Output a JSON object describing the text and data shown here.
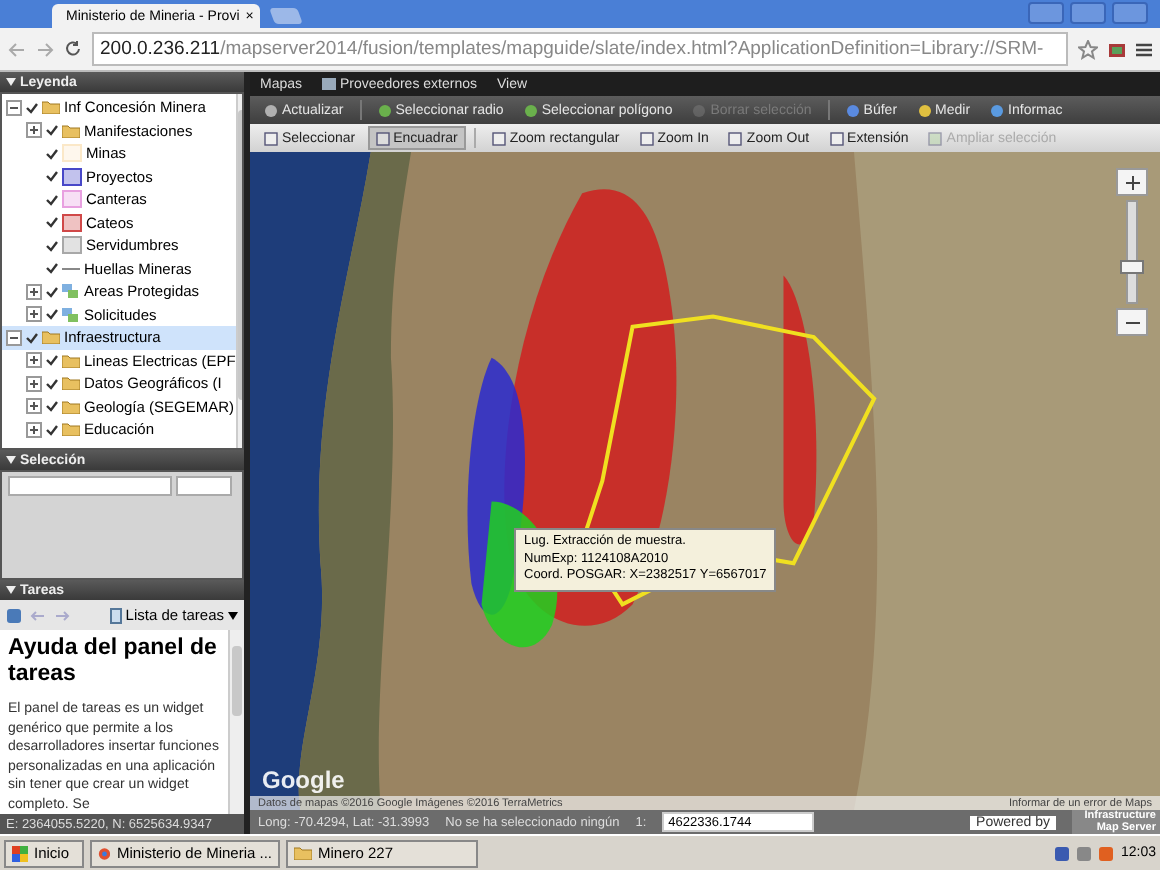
{
  "browser": {
    "tab_title": "Ministerio de Mineria - Provi",
    "close": "×",
    "url_host": "200.0.236.211",
    "url_path": "/mapserver2014/fusion/templates/mapguide/slate/index.html?ApplicationDefinition=Library://SRM-"
  },
  "legend": {
    "title": "Leyenda",
    "items": [
      {
        "label": "Inf Concesión Minera",
        "kind": "folder",
        "checked": true,
        "expanded": true,
        "selected": false,
        "children": [
          {
            "label": "Manifestaciones",
            "kind": "folder",
            "checked": true,
            "expanded": false,
            "selected": false
          },
          {
            "label": "Minas",
            "kind": "layer",
            "color": "#fbe8c8",
            "checked": true,
            "selected": false
          },
          {
            "label": "Proyectos",
            "kind": "layer",
            "color": "#4848c8",
            "checked": true,
            "selected": false
          },
          {
            "label": "Canteras",
            "kind": "layer",
            "color": "#e8a0e0",
            "checked": true,
            "selected": false
          },
          {
            "label": "Cateos",
            "kind": "layer",
            "color": "#d04848",
            "checked": true,
            "selected": false
          },
          {
            "label": "Servidumbres",
            "kind": "layer",
            "color": "#a8a8a8",
            "checked": true,
            "selected": false
          },
          {
            "label": "Huellas Mineras",
            "kind": "line",
            "checked": true,
            "selected": false
          },
          {
            "label": "Areas Protegidas",
            "kind": "group",
            "checked": true,
            "expanded": false,
            "selected": false
          },
          {
            "label": "Solicitudes",
            "kind": "group",
            "checked": true,
            "expanded": false,
            "selected": false
          }
        ]
      },
      {
        "label": "Infraestructura",
        "kind": "folder",
        "checked": true,
        "expanded": true,
        "selected": true,
        "children": [
          {
            "label": "Lineas Electricas (EPF",
            "kind": "folder",
            "checked": true,
            "expanded": false,
            "selected": false
          },
          {
            "label": "Datos Geográficos (I",
            "kind": "folder",
            "checked": true,
            "expanded": false,
            "selected": false
          },
          {
            "label": "Geología (SEGEMAR)",
            "kind": "folder",
            "checked": true,
            "expanded": false,
            "selected": false
          },
          {
            "label": "Educación",
            "kind": "folder",
            "checked": true,
            "expanded": false,
            "selected": false
          }
        ]
      }
    ]
  },
  "selection": {
    "title": "Selección"
  },
  "tasks": {
    "title": "Tareas",
    "menu": "Lista de tareas",
    "heading": "Ayuda del panel de tareas",
    "body": "El panel de tareas es un widget genérico que permite a los desarrolladores insertar funciones personalizadas en una aplicación sin tener que crear un widget completo. Se"
  },
  "menu": [
    "Mapas",
    "Proveedores externos",
    "View"
  ],
  "toolbar1": [
    {
      "label": "Actualizar",
      "disabled": false
    },
    {
      "label": "Seleccionar radio",
      "disabled": false
    },
    {
      "label": "Seleccionar polígono",
      "disabled": false
    },
    {
      "label": "Borrar selección",
      "disabled": true
    },
    {
      "label": "Búfer",
      "disabled": false
    },
    {
      "label": "Medir",
      "disabled": false
    },
    {
      "label": "Informac",
      "disabled": false
    }
  ],
  "toolbar2": [
    {
      "label": "Seleccionar",
      "selected": false,
      "disabled": false
    },
    {
      "label": "Encuadrar",
      "selected": true,
      "disabled": false
    },
    {
      "label": "Zoom rectangular",
      "selected": false,
      "disabled": false
    },
    {
      "label": "Zoom In",
      "selected": false,
      "disabled": false
    },
    {
      "label": "Zoom Out",
      "selected": false,
      "disabled": false
    },
    {
      "label": "Extensión",
      "selected": false,
      "disabled": false
    },
    {
      "label": "Ampliar selección",
      "selected": false,
      "disabled": true
    }
  ],
  "map": {
    "zoom": {
      "level": 0.35
    },
    "tooltip": [
      "Lug. Extracción de muestra.",
      "NumExp: 1124108A2010",
      "Coord. POSGAR: X=2382517 Y=6567017"
    ],
    "logo": "Google",
    "attribution": "Datos de mapas ©2016 Google Imágenes ©2016 TerraMetrics",
    "report": "Informar de un error de Maps"
  },
  "status": {
    "projected": "E: 2364055.5220, N: 6525634.9347",
    "geographic": "Long: -70.4294, Lat: -31.3993",
    "selection": "No se ha seleccionado ningún",
    "scale_label": "1:",
    "scale": "4622336.1744",
    "powered": "Powered by",
    "brand": "Infrastructure Map Server"
  },
  "taskbar": {
    "start": "Inicio",
    "windows": [
      "Ministerio de Mineria ...",
      "Minero 227"
    ],
    "clock": "12:03"
  }
}
